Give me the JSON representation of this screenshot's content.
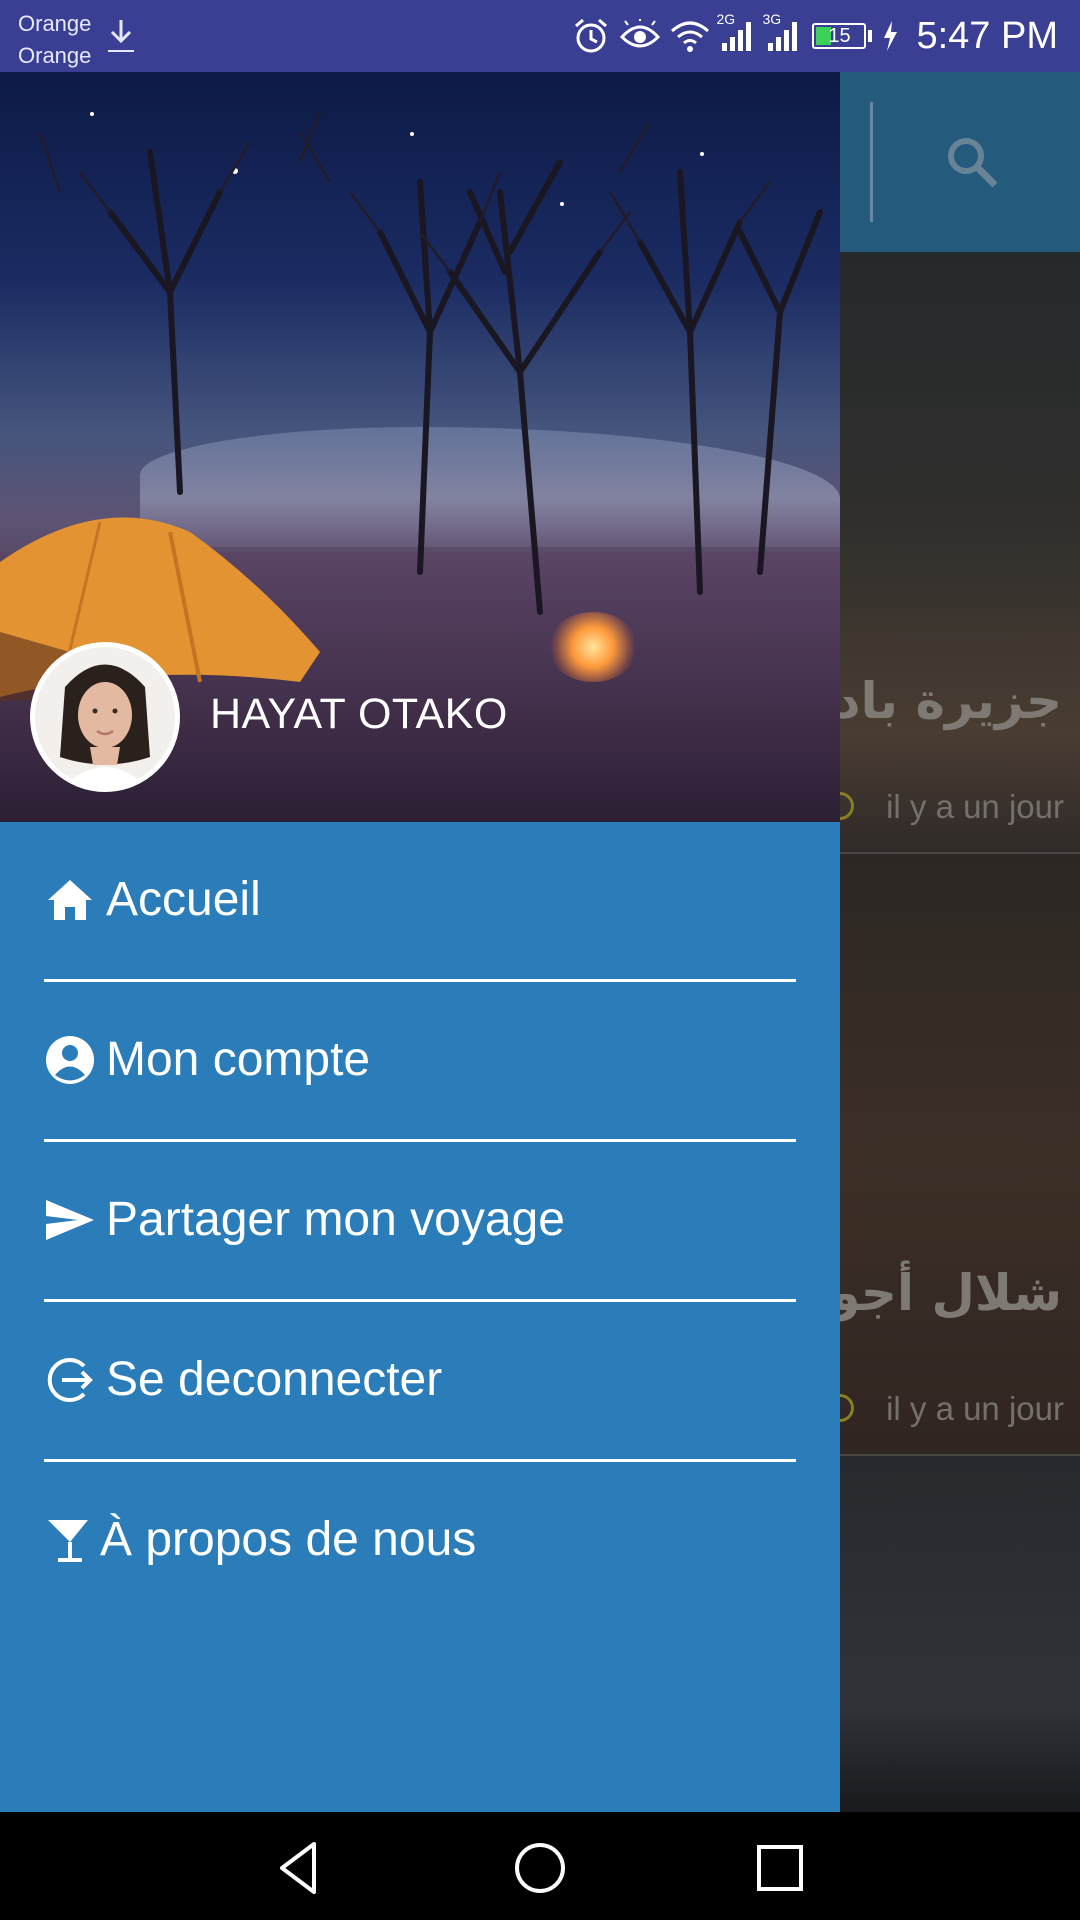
{
  "status_bar": {
    "carrier_1": "Orange",
    "carrier_2": "Orange",
    "network_1": "2G",
    "network_2": "3G",
    "battery": "15",
    "time": "5:47 PM"
  },
  "background_feed": {
    "cards": [
      {
        "title": "جزيرة باديس",
        "time": "il y a un jour"
      },
      {
        "title": "شلال أجوج",
        "time": "il y a un jour"
      }
    ]
  },
  "drawer": {
    "user_name": "HAYAT OTAKO",
    "menu": [
      {
        "label": "Accueil",
        "icon": "home-icon"
      },
      {
        "label": "Mon compte",
        "icon": "account-circle-icon"
      },
      {
        "label": "Partager mon voyage",
        "icon": "send-icon"
      },
      {
        "label": "Se deconnecter",
        "icon": "logout-icon"
      },
      {
        "label": "À propos de nous",
        "icon": "cocktail-icon"
      }
    ]
  },
  "colors": {
    "status_bar": "#3a3f94",
    "drawer": "#2b7dba",
    "toolbar": "#2c6e98"
  }
}
